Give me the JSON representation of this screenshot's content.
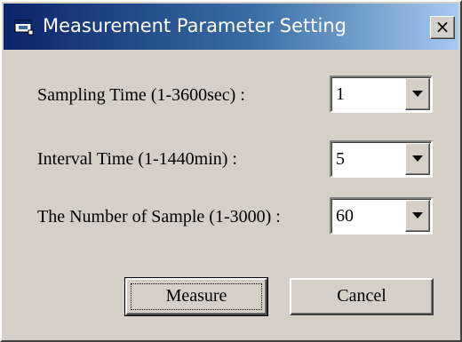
{
  "window": {
    "title": "Measurement Parameter Setting",
    "close_label": "×"
  },
  "fields": [
    {
      "label": "Sampling Time (1-3600sec) :",
      "value": "1"
    },
    {
      "label": "Interval Time (1-1440min) :",
      "value": "5"
    },
    {
      "label": "The Number of Sample (1-3000) :",
      "value": "60"
    }
  ],
  "buttons": {
    "measure_label": "Measure",
    "cancel_label": "Cancel"
  },
  "icons": {
    "title_icon": "window-app-icon",
    "close_icon": "close-icon",
    "dropdown_icon": "chevron-down-icon"
  },
  "colors": {
    "titlebar_start": "#0a246a",
    "titlebar_end": "#a6caf0",
    "dialog_face": "#d4d0c8"
  }
}
